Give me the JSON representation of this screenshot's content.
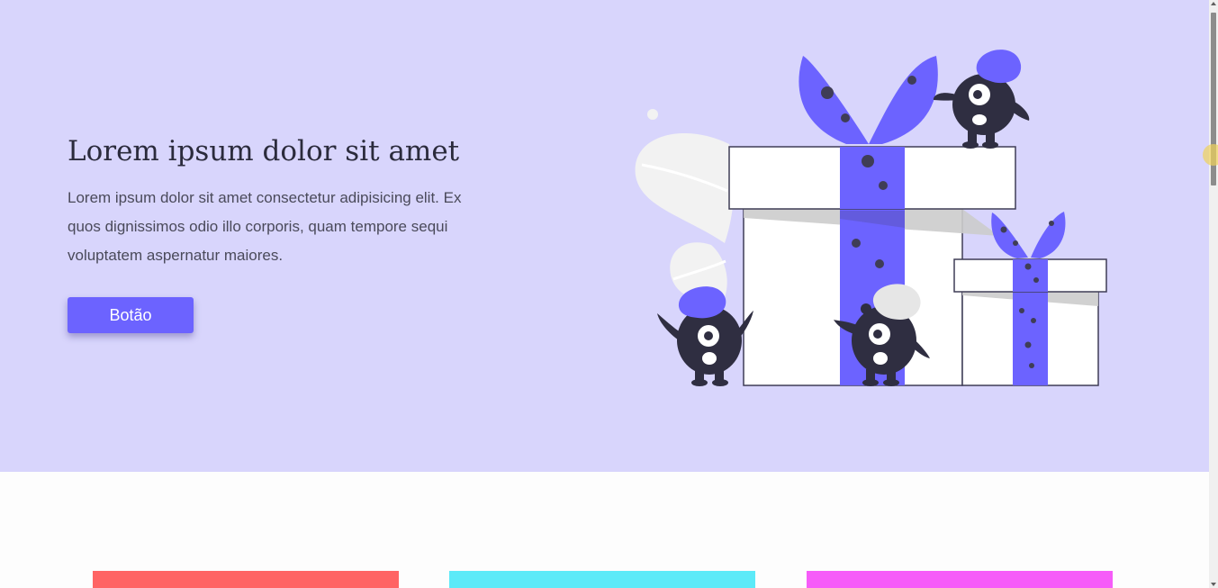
{
  "hero": {
    "title": "Lorem ipsum dolor sit amet",
    "text": "Lorem ipsum dolor sit amet consectetur adipisicing elit. Ex quos dignissimos odio illo corporis, quam tempore sequi voluptatem aspernatur maiores.",
    "button_label": "Botão"
  },
  "colors": {
    "hero_background": "#d8d5fc",
    "accent": "#6c63ff",
    "card_1": "#ff6464",
    "card_2": "#5ceaf8",
    "card_3": "#f65cf9"
  },
  "illustration": {
    "icon": "gift-boxes-with-monsters-illustration"
  }
}
